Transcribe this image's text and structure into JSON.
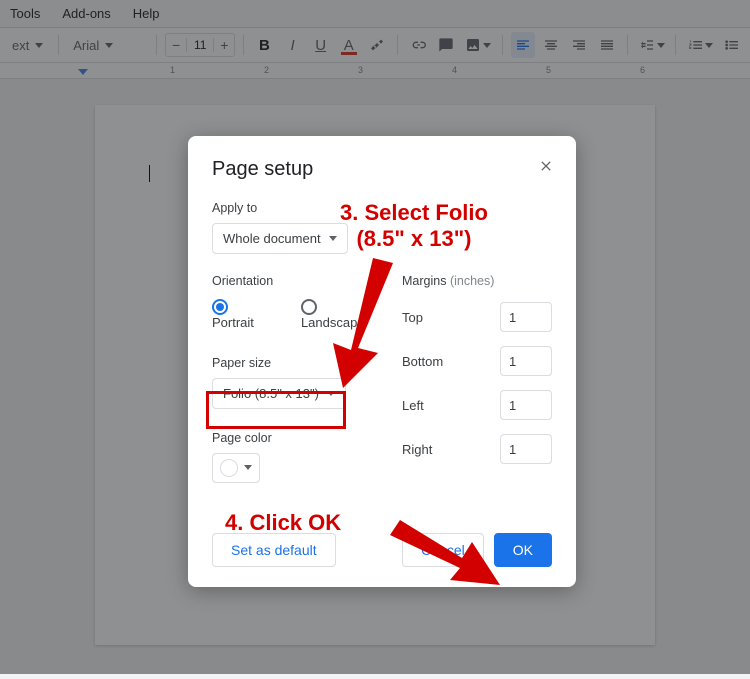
{
  "menu": {
    "tools": "Tools",
    "addons": "Add-ons",
    "help": "Help"
  },
  "toolbar": {
    "style": "ext",
    "font": "Arial",
    "size": "11",
    "minus": "−",
    "plus": "+"
  },
  "ruler": {
    "n1": "1",
    "n2": "2",
    "n3": "3",
    "n4": "4",
    "n5": "5",
    "n6": "6"
  },
  "dialog": {
    "title": "Page setup",
    "apply_to_label": "Apply to",
    "apply_to_value": "Whole document",
    "orientation_label": "Orientation",
    "portrait": "Portrait",
    "landscape": "Landscape",
    "paper_size_label": "Paper size",
    "paper_size_value": "Folio (8.5\" x 13\")",
    "page_color_label": "Page color",
    "margins_label": "Margins",
    "margins_hint": "(inches)",
    "top": "Top",
    "bottom": "Bottom",
    "left": "Left",
    "right": "Right",
    "m_top": "1",
    "m_bottom": "1",
    "m_left": "1",
    "m_right": "1",
    "set_default": "Set as default",
    "cancel": "Cancel",
    "ok": "OK"
  },
  "annot": {
    "step3a": "3. Select Folio",
    "step3b": "(8.5\" x 13\")",
    "step4": "4. Click OK"
  }
}
